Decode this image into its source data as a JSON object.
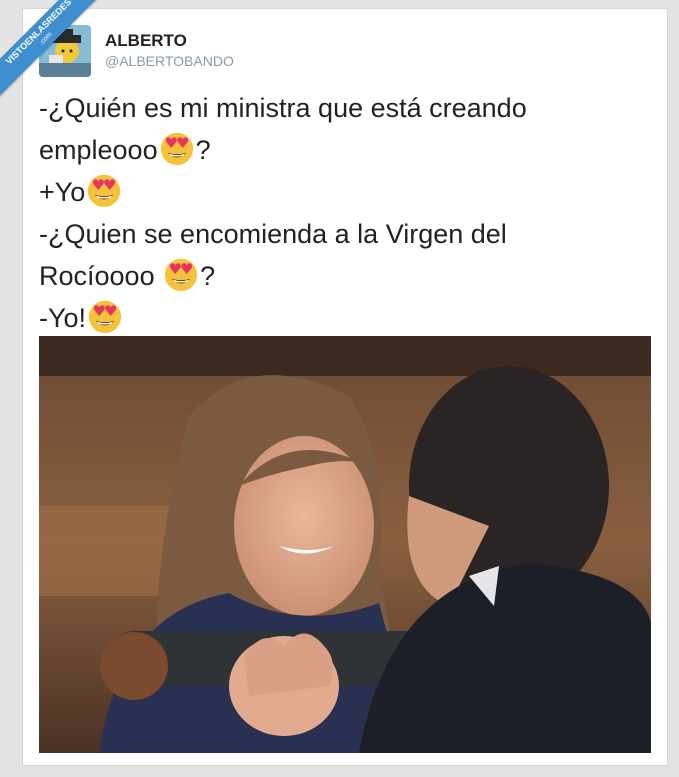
{
  "watermark": {
    "text": "VISTOENLASREDES",
    "sub": ".com"
  },
  "user": {
    "name": "ALBERTO",
    "handle": "@ALBERTOBANDO"
  },
  "tweet": {
    "line1": "-¿Quién es mi ministra que está creando",
    "line2": "empleooo",
    "line2_end": "?",
    "line3": "+Yo",
    "line4": "-¿Quien se encomienda a la Virgen del",
    "line5": "Rocíoooo ",
    "line5_end": "?",
    "line6": "-Yo!"
  },
  "icons": {
    "emoji": "smiling-face-with-heart-eyes-icon"
  },
  "colors": {
    "ribbon": "#3d8fd0",
    "handle": "#8899a6"
  }
}
